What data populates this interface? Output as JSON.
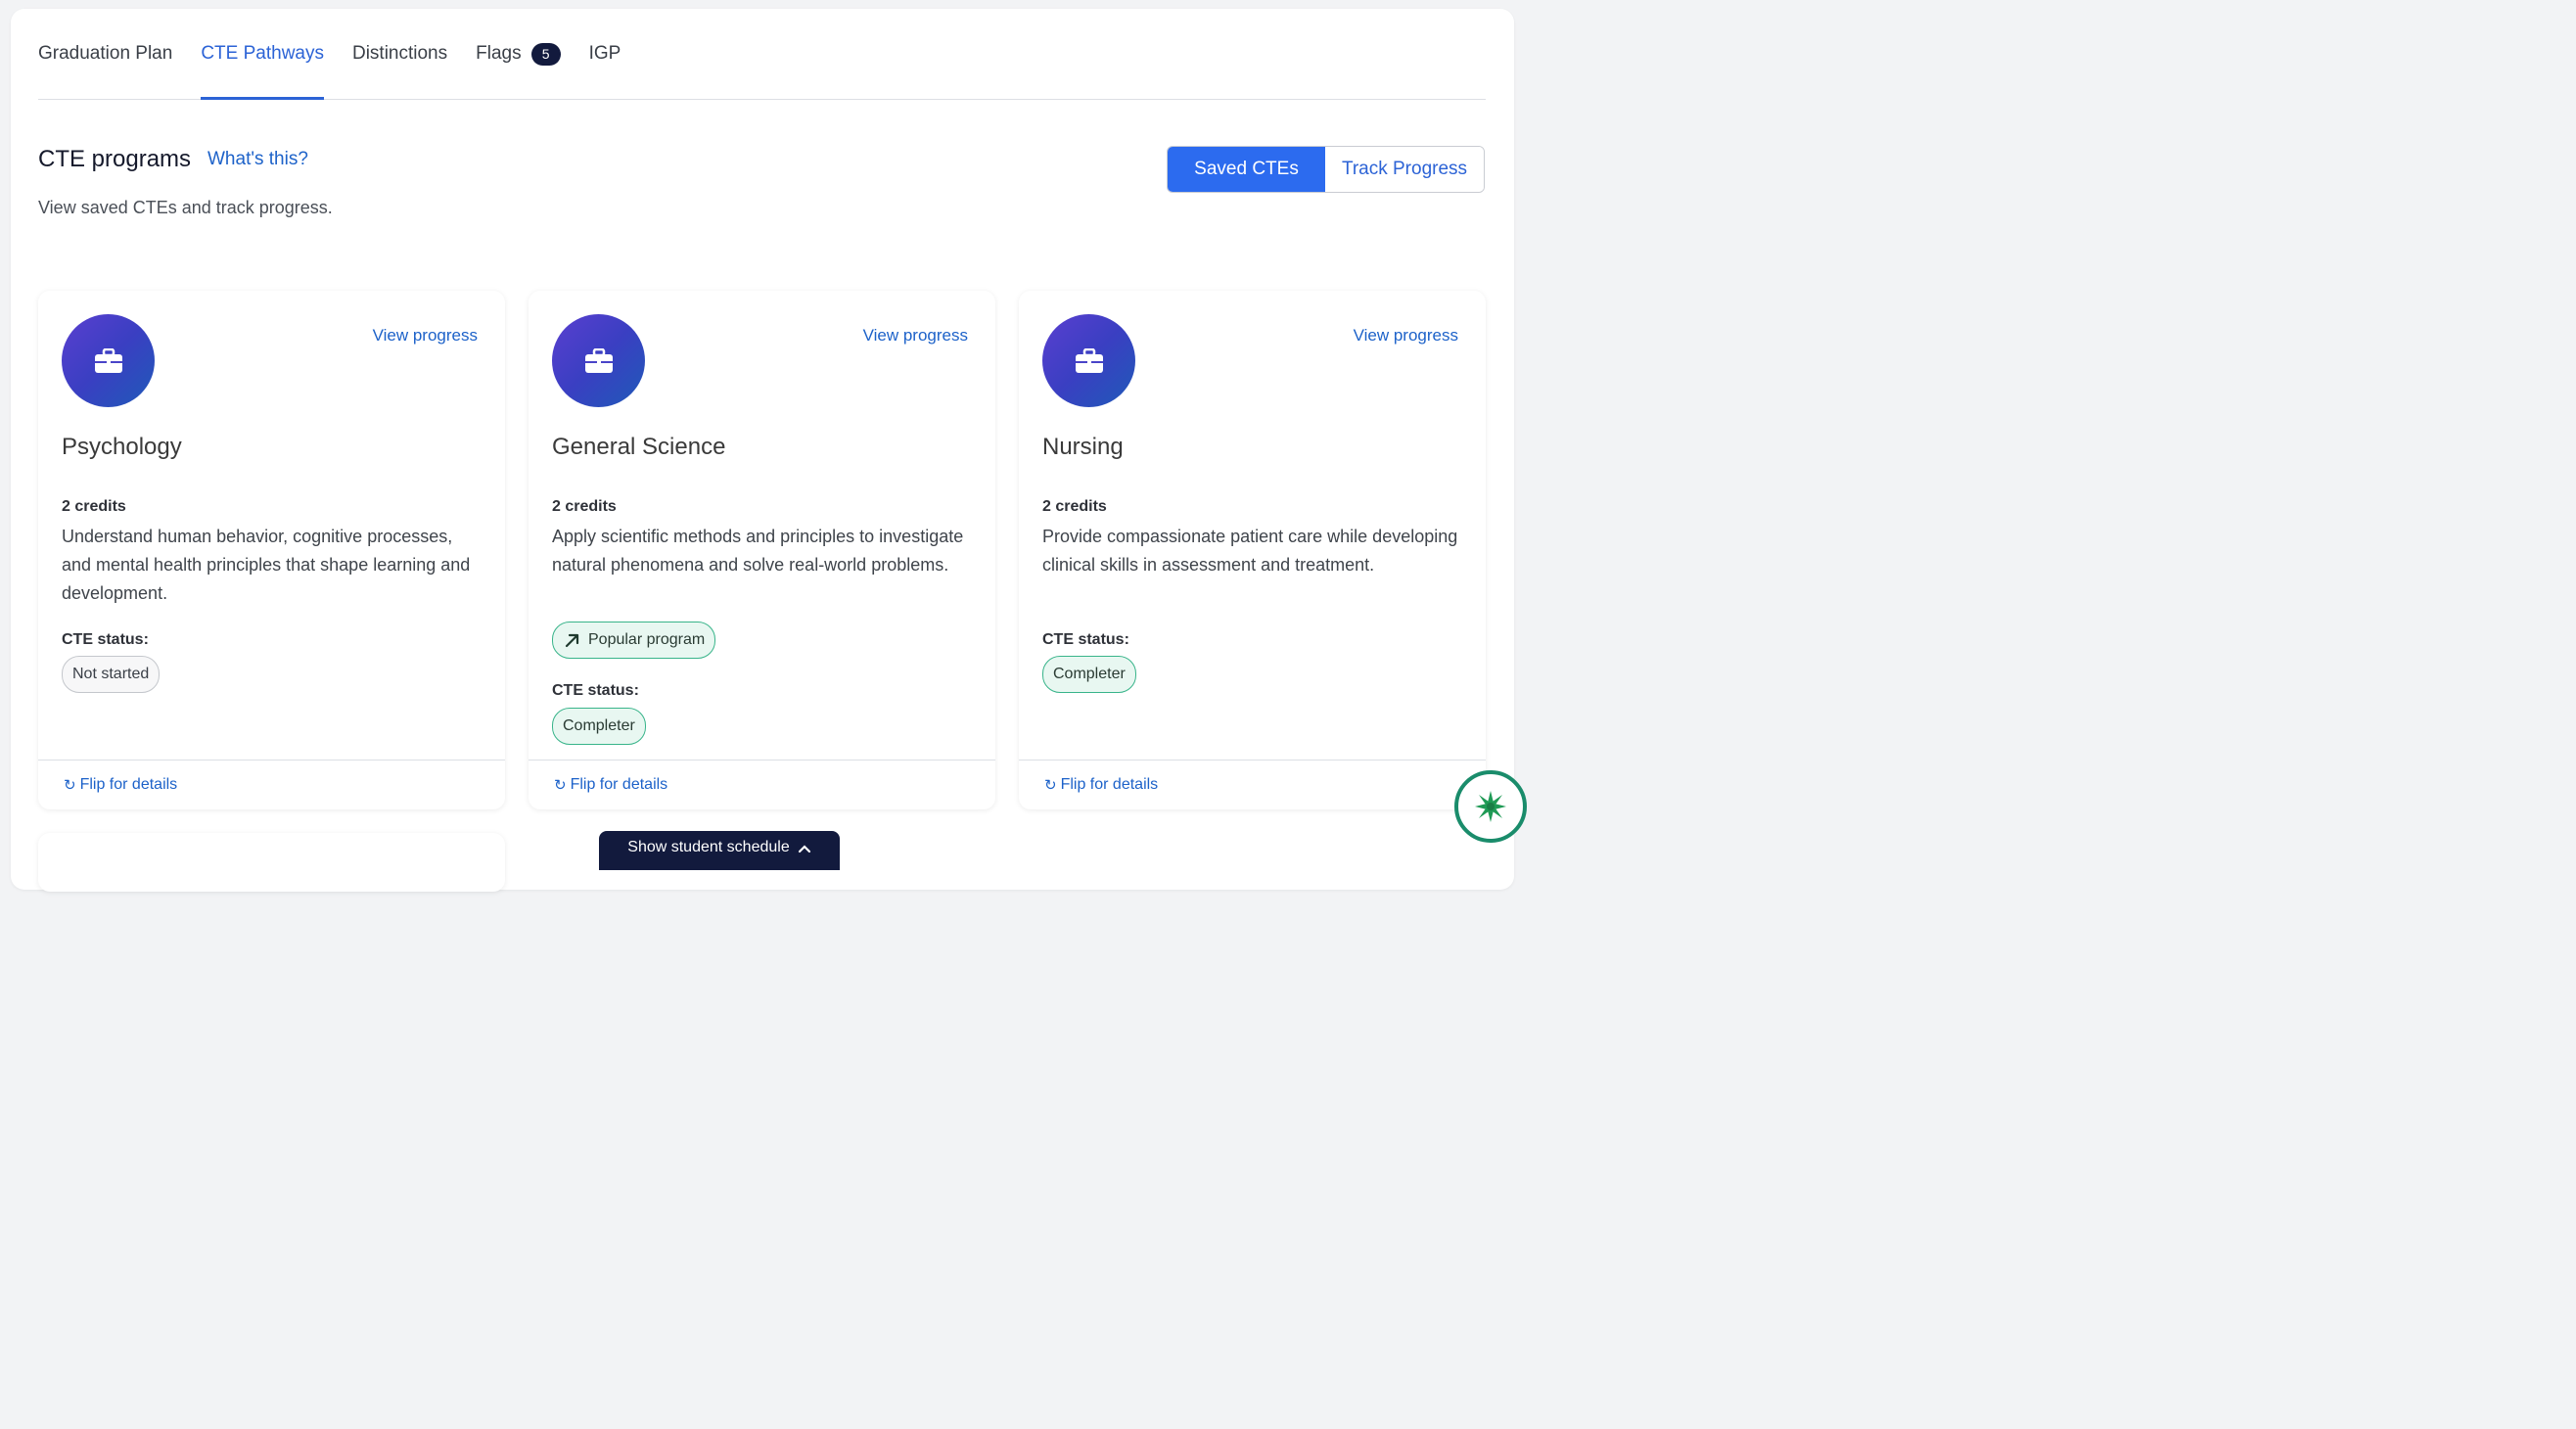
{
  "tabs": [
    {
      "label": "Graduation Plan",
      "active": false
    },
    {
      "label": "CTE Pathways",
      "active": true
    },
    {
      "label": "Distinctions",
      "active": false
    },
    {
      "label": "Flags",
      "active": false,
      "badge": "5"
    },
    {
      "label": "IGP",
      "active": false
    }
  ],
  "header": {
    "title": "CTE programs",
    "help_link": "What's this?",
    "subtitle": "View saved CTEs and track progress."
  },
  "toggle": {
    "saved": "Saved CTEs",
    "track": "Track Progress",
    "selected": "Saved CTEs"
  },
  "cards": [
    {
      "icon": "briefcase-icon",
      "view_progress": "View progress",
      "title": "Psychology",
      "credits": "2 credits",
      "description": "Understand human behavior, cognitive processes, and mental health principles that shape learning and development.",
      "status_label": "CTE status:",
      "status": "Not started",
      "flip": "Flip for details"
    },
    {
      "icon": "briefcase-icon",
      "view_progress": "View progress",
      "title": "General Science",
      "credits": "2 credits",
      "description": "Apply scientific methods and principles to investigate natural phenomena and solve real-world problems.",
      "popular": "Popular program",
      "status_label": "CTE status:",
      "status": "Completer",
      "flip": "Flip for details"
    },
    {
      "icon": "briefcase-icon",
      "view_progress": "View progress",
      "title": "Nursing",
      "credits": "2 credits",
      "description": "Provide compassionate patient care while developing clinical skills in assessment and treatment.",
      "status_label": "CTE status:",
      "status": "Completer",
      "flip": "Flip for details"
    }
  ],
  "schedule_button": "Show student schedule",
  "colors": {
    "accent": "#2c6bef",
    "link": "#1d62c9",
    "navy": "#121a3d",
    "success": "#38b48a"
  }
}
